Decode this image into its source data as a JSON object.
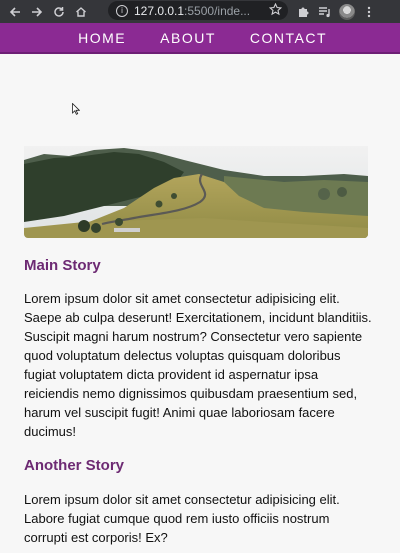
{
  "browser": {
    "url_host": "127.0.0.1",
    "url_rest": ":5500/inde..."
  },
  "nav": {
    "items": [
      "HOME",
      "ABOUT",
      "CONTACT"
    ]
  },
  "main_story": {
    "title": "Main Story",
    "body": "Lorem ipsum dolor sit amet consectetur adipisicing elit. Saepe ab culpa deserunt! Exercitationem, incidunt blanditiis. Suscipit magni harum nostrum? Consectetur vero sapiente quod voluptatum delectus voluptas quisquam doloribus fugiat voluptatem dicta provident id aspernatur ipsa reiciendis nemo dignissimos quibusdam praesentium sed, harum vel suscipit fugit! Animi quae laboriosam facere ducimus!"
  },
  "another_story": {
    "title": "Another Story",
    "body": "Lorem ipsum dolor sit amet consectetur adipisicing elit. Labore fugiat cumque quod rem iusto officiis nostrum corrupti est corporis! Ex?"
  },
  "colors": {
    "nav_bg": "#8b2a93",
    "heading": "#6d2a73"
  }
}
